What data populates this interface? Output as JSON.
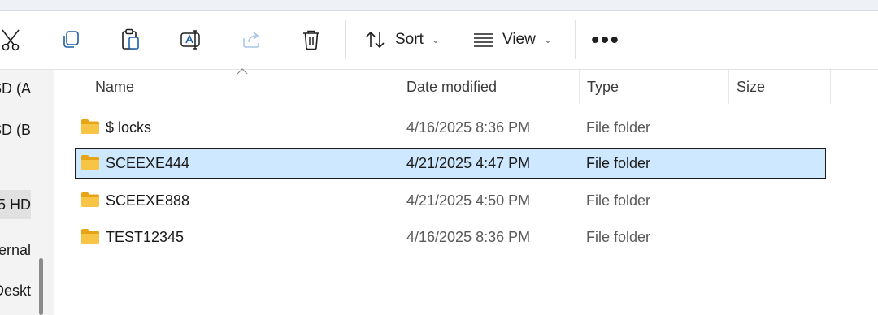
{
  "toolbar": {
    "icons": [
      "cut-icon",
      "copy-icon",
      "paste-icon",
      "rename-icon",
      "share-icon",
      "delete-icon"
    ],
    "sort_label": "Sort",
    "view_label": "View",
    "more_label": "•••"
  },
  "sidebar": {
    "items": [
      {
        "label": "SD (A"
      },
      {
        "label": "SD (B"
      },
      {
        "label": ".5 HD"
      },
      {
        "label": "ernal"
      },
      {
        "label": "Deskt"
      }
    ]
  },
  "columns": {
    "name": "Name",
    "date": "Date modified",
    "type": "Type",
    "size": "Size"
  },
  "files": [
    {
      "name": "$ locks",
      "date": "4/16/2025 8:36 PM",
      "type": "File folder",
      "selected": false
    },
    {
      "name": "SCEEXE444",
      "date": "4/21/2025 4:47 PM",
      "type": "File folder",
      "selected": true
    },
    {
      "name": "SCEEXE888",
      "date": "4/21/2025 4:50 PM",
      "type": "File folder",
      "selected": false
    },
    {
      "name": "TEST12345",
      "date": "4/16/2025 8:36 PM",
      "type": "File folder",
      "selected": false
    }
  ],
  "colors": {
    "selection_bg": "#cde8ff",
    "folder_yellow": "#f8c446",
    "folder_dark": "#e8a417"
  }
}
